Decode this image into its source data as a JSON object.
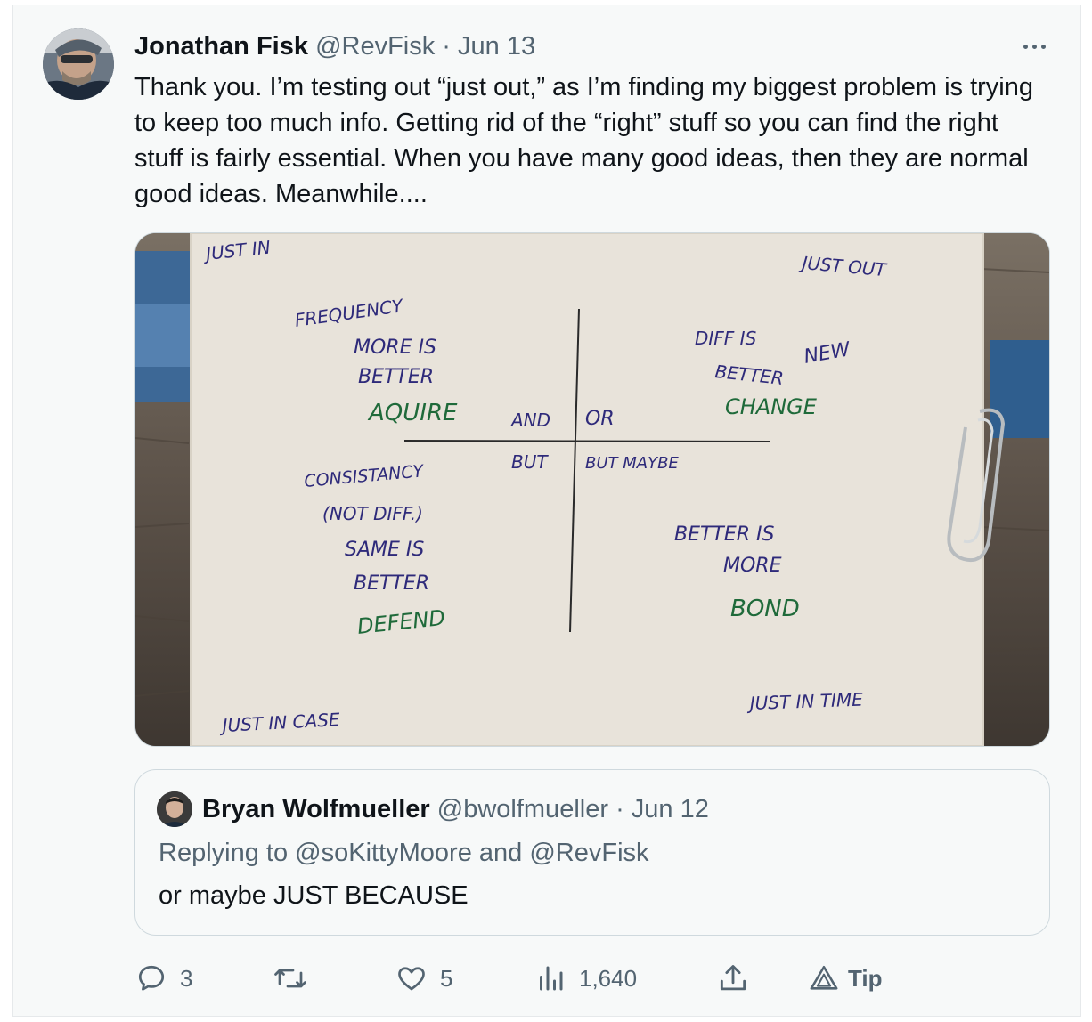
{
  "tweet": {
    "author_name": "Jonathan Fisk",
    "handle": "@RevFisk",
    "separator": "·",
    "date": "Jun 13",
    "text": "Thank you. I’m testing out “just out,” as I’m finding my biggest problem is trying to keep too much info. Getting rid of the “right” stuff so you can find the right stuff is fairly essential. When you have many good ideas, then they are normal good ideas. Meanwhile...."
  },
  "media": {
    "notes": {
      "just_in": "JUST IN",
      "just_out": "JUST OUT",
      "frequency": "FREQUENCY",
      "more_is": "MORE IS",
      "better_tl": "BETTER",
      "aquire": "AQUIRE",
      "and": "AND",
      "or": "OR",
      "diff_is": "DIFF IS",
      "better_tr": "BETTER",
      "new": "NEW",
      "change": "CHANGE",
      "but": "BUT",
      "but_maybe": "BUT MAYBE",
      "consistancy": "CONSISTANCY",
      "not_diff": "(NOT DIFF.)",
      "same_is": "SAME IS",
      "better_bl": "BETTER",
      "defend": "DEFEND",
      "better_is": "BETTER IS",
      "more": "MORE",
      "bond": "BOND",
      "just_in_case": "JUST IN CASE",
      "just_in_time": "JUST IN TIME"
    }
  },
  "quote": {
    "author_name": "Bryan Wolfmueller",
    "handle": "@bwolfmueller",
    "separator": "·",
    "date": "Jun 12",
    "reply_prefix": "Replying to",
    "reply_user1": "@soKittyMoore",
    "reply_and": "and",
    "reply_user2": "@RevFisk",
    "text": "or maybe JUST BECAUSE"
  },
  "actions": {
    "replies": "3",
    "retweets": "",
    "likes": "5",
    "views": "1,640",
    "tip": "Tip"
  },
  "colors": {
    "text_primary": "#0f1419",
    "text_secondary": "#536471",
    "link_blue": "#1d9bf0",
    "ink_blue": "#2e2a7a",
    "ink_green": "#1f6a3a"
  }
}
